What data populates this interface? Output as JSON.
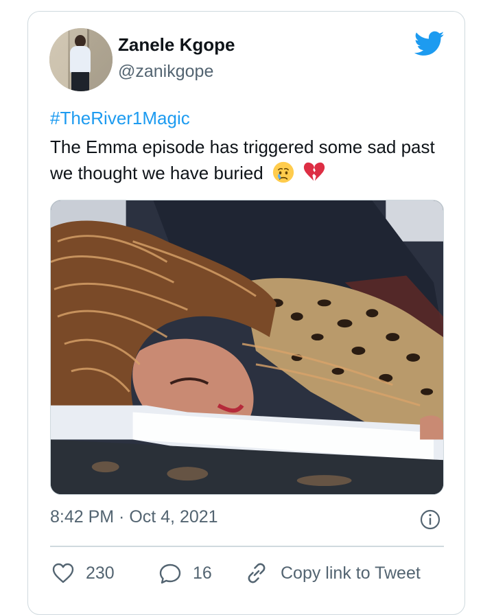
{
  "tweet": {
    "author_name": "Zanele Kgope",
    "author_handle": "@zanikgope",
    "hashtag": "#TheRiver1Magic",
    "text": "The Emma episode has triggered some sad past we thought we have buried",
    "emojis": [
      "crying-face",
      "broken-heart"
    ],
    "timestamp": "8:42 PM · Oct 4, 2021"
  },
  "actions": {
    "like_count": "230",
    "reply_count": "16",
    "copy_link_label": "Copy link to Tweet"
  },
  "colors": {
    "accent": "#1d9bf0",
    "secondary_text": "#536471",
    "border": "#cfd9de",
    "broken_heart": "#dd2e44",
    "emoji_face": "#ffcc4d"
  },
  "icons": {
    "brand": "twitter-bird-icon",
    "info": "info-icon",
    "like": "heart-icon",
    "reply": "reply-bubble-icon",
    "copy": "link-icon"
  }
}
